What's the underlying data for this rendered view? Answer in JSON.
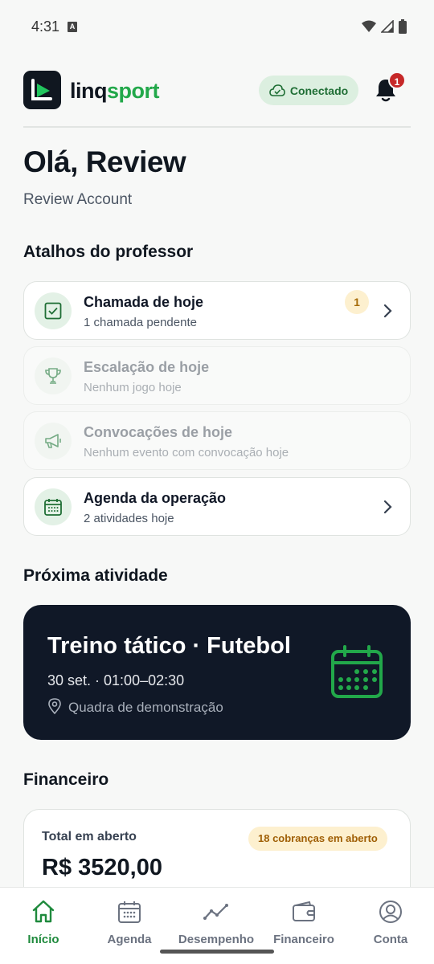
{
  "status_bar": {
    "time": "4:31",
    "notification_glyph": "A"
  },
  "header": {
    "logo_part1": "linq",
    "logo_part2": "sport",
    "connection_label": "Conectado",
    "notification_count": "1"
  },
  "greeting": {
    "title": "Olá, Review",
    "account_name": "Review Account"
  },
  "shortcuts": {
    "title": "Atalhos do professor",
    "items": [
      {
        "title": "Chamada de hoje",
        "subtitle": "1 chamada pendente",
        "badge": "1",
        "icon": "checkbox-icon",
        "enabled": true
      },
      {
        "title": "Escalação de hoje",
        "subtitle": "Nenhum jogo hoje",
        "icon": "trophy-icon",
        "enabled": false
      },
      {
        "title": "Convocações de hoje",
        "subtitle": "Nenhum evento com convocação hoje",
        "icon": "megaphone-icon",
        "enabled": false
      },
      {
        "title": "Agenda da operação",
        "subtitle": "2 atividades hoje",
        "icon": "calendar-icon",
        "enabled": true
      }
    ]
  },
  "next_activity": {
    "title": "Próxima atividade",
    "name": "Treino tático · Futebol",
    "datetime": "30 set. · 01:00–02:30",
    "location": "Quadra de demonstração"
  },
  "financial": {
    "title": "Financeiro",
    "label": "Total em aberto",
    "badge": "18 cobranças em aberto",
    "value": "R$ 3520,00"
  },
  "bottom_nav": {
    "items": [
      {
        "label": "Início",
        "icon": "home-icon",
        "active": true
      },
      {
        "label": "Agenda",
        "icon": "calendar-icon",
        "active": false
      },
      {
        "label": "Desempenho",
        "icon": "trend-icon",
        "active": false
      },
      {
        "label": "Financeiro",
        "icon": "wallet-icon",
        "active": false
      },
      {
        "label": "Conta",
        "icon": "user-circle-icon",
        "active": false
      }
    ]
  },
  "colors": {
    "brand_green": "#22a84a",
    "dark": "#101827",
    "warning_bg": "#fdf0cf",
    "alert_red": "#c62828"
  }
}
